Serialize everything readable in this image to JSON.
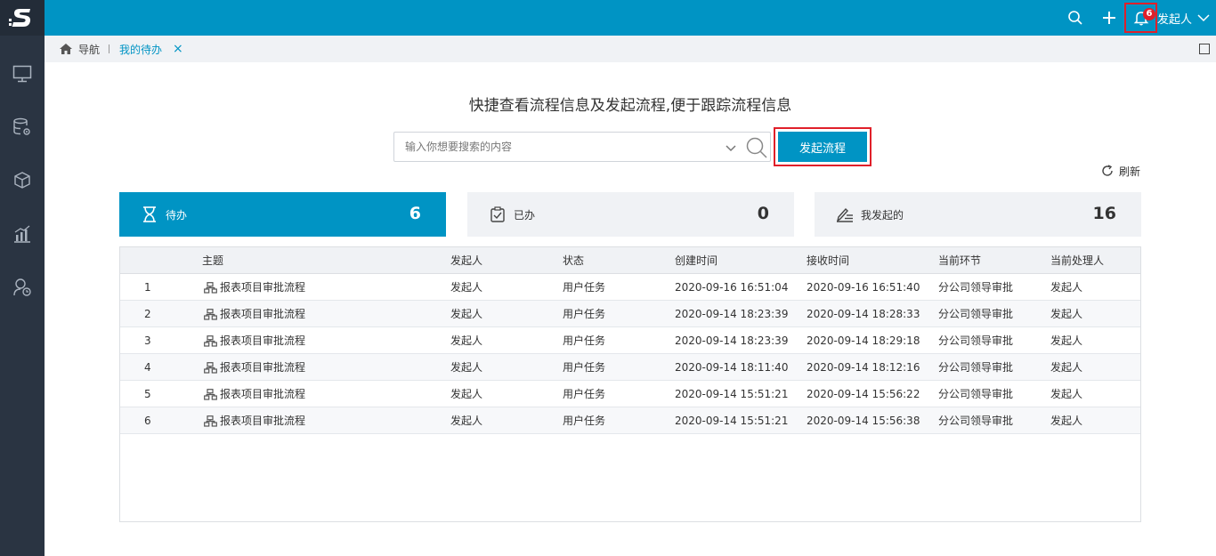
{
  "colors": {
    "accent": "#0094c4",
    "sidebar": "#2a3442",
    "highlight_border": "#e0202a",
    "panel_gray": "#f0f2f5"
  },
  "sidebar": {
    "logo_icon": "s-logo-icon",
    "items": [
      {
        "icon": "monitor-icon"
      },
      {
        "icon": "database-settings-icon"
      },
      {
        "icon": "cubes-icon"
      },
      {
        "icon": "bar-chart-icon"
      },
      {
        "icon": "user-process-icon"
      }
    ]
  },
  "header": {
    "search_icon": "search-icon",
    "add_icon": "plus-icon",
    "notification_count": "6",
    "user_name": "发起人"
  },
  "tabs": {
    "home_label": "导航",
    "active_tab_label": "我的待办",
    "close_glyph": "×"
  },
  "main": {
    "headline": "快捷查看流程信息及发起流程,便于跟踪流程信息",
    "search_placeholder": "输入你想要搜索的内容",
    "launch_button": "发起流程",
    "refresh_label": "刷新"
  },
  "summary_cards": [
    {
      "label": "待办",
      "count": "6",
      "icon": "hourglass-icon",
      "active": true
    },
    {
      "label": "已办",
      "count": "0",
      "icon": "checked-clipboard-icon",
      "active": false
    },
    {
      "label": "我发起的",
      "count": "16",
      "icon": "edit-list-icon",
      "active": false
    }
  ],
  "table": {
    "columns": [
      "主题",
      "发起人",
      "状态",
      "创建时间",
      "接收时间",
      "当前环节",
      "当前处理人"
    ],
    "rows": [
      {
        "index": "1",
        "subject": "报表项目审批流程",
        "initiator": "发起人",
        "status": "用户任务",
        "created": "2020-09-16 16:51:04",
        "received": "2020-09-16 16:51:40",
        "stage": "分公司领导审批",
        "handler": "发起人"
      },
      {
        "index": "2",
        "subject": "报表项目审批流程",
        "initiator": "发起人",
        "status": "用户任务",
        "created": "2020-09-14 18:23:39",
        "received": "2020-09-14 18:28:33",
        "stage": "分公司领导审批",
        "handler": "发起人"
      },
      {
        "index": "3",
        "subject": "报表项目审批流程",
        "initiator": "发起人",
        "status": "用户任务",
        "created": "2020-09-14 18:23:39",
        "received": "2020-09-14 18:29:18",
        "stage": "分公司领导审批",
        "handler": "发起人"
      },
      {
        "index": "4",
        "subject": "报表项目审批流程",
        "initiator": "发起人",
        "status": "用户任务",
        "created": "2020-09-14 18:11:40",
        "received": "2020-09-14 18:12:16",
        "stage": "分公司领导审批",
        "handler": "发起人"
      },
      {
        "index": "5",
        "subject": "报表项目审批流程",
        "initiator": "发起人",
        "status": "用户任务",
        "created": "2020-09-14 15:51:21",
        "received": "2020-09-14 15:56:22",
        "stage": "分公司领导审批",
        "handler": "发起人"
      },
      {
        "index": "6",
        "subject": "报表项目审批流程",
        "initiator": "发起人",
        "status": "用户任务",
        "created": "2020-09-14 15:51:21",
        "received": "2020-09-14 15:56:38",
        "stage": "分公司领导审批",
        "handler": "发起人"
      }
    ]
  }
}
